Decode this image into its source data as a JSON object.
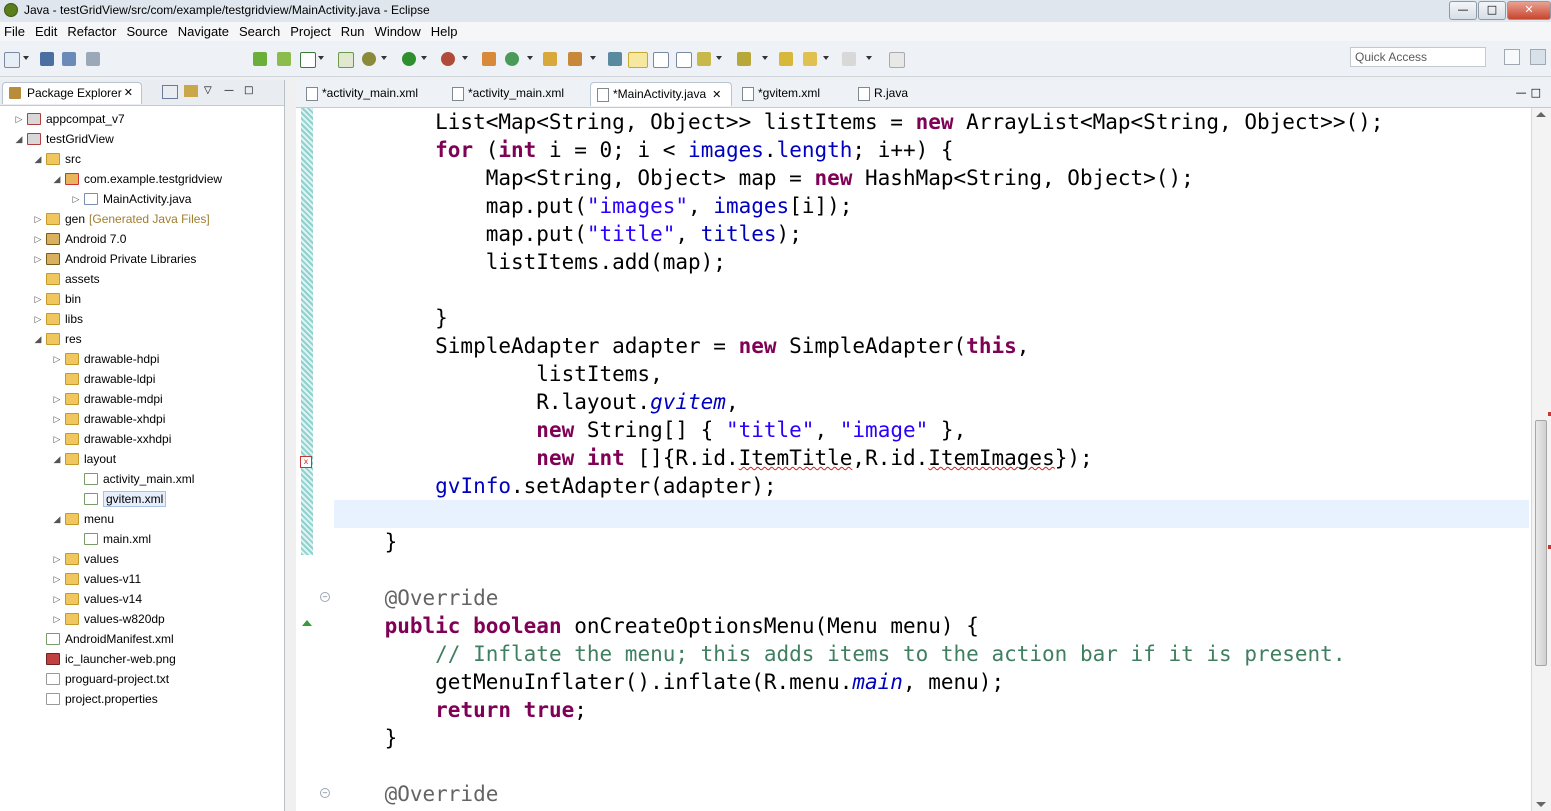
{
  "window": {
    "title": "Java - testGridView/src/com/example/testgridview/MainActivity.java - Eclipse"
  },
  "menu": [
    "File",
    "Edit",
    "Refactor",
    "Source",
    "Navigate",
    "Search",
    "Project",
    "Run",
    "Window",
    "Help"
  ],
  "quick_access": {
    "placeholder": "Quick Access"
  },
  "package_explorer": {
    "tab_label": "Package Explorer",
    "tree": [
      {
        "label": "appcompat_v7",
        "icon": "project-icon",
        "depth": 0,
        "twisty": "collapsed"
      },
      {
        "label": "testGridView",
        "icon": "project-icon",
        "depth": 0,
        "twisty": "expanded"
      },
      {
        "label": "src",
        "icon": "folder-icon",
        "depth": 1,
        "twisty": "expanded"
      },
      {
        "label": "com.example.testgridview",
        "icon": "package-icon",
        "depth": 2,
        "twisty": "expanded"
      },
      {
        "label": "MainActivity.java",
        "icon": "java-file-icon",
        "depth": 3,
        "twisty": "collapsed"
      },
      {
        "label": "gen",
        "decor": "[Generated Java Files]",
        "icon": "folder-icon",
        "depth": 1,
        "twisty": "collapsed"
      },
      {
        "label": "Android 7.0",
        "icon": "library-icon",
        "depth": 1,
        "twisty": "collapsed"
      },
      {
        "label": "Android Private Libraries",
        "icon": "library-icon",
        "depth": 1,
        "twisty": "collapsed"
      },
      {
        "label": "assets",
        "icon": "folder-icon",
        "depth": 1,
        "twisty": "none"
      },
      {
        "label": "bin",
        "icon": "folder-icon",
        "depth": 1,
        "twisty": "collapsed"
      },
      {
        "label": "libs",
        "icon": "folder-icon",
        "depth": 1,
        "twisty": "collapsed"
      },
      {
        "label": "res",
        "icon": "folder-icon",
        "depth": 1,
        "twisty": "expanded"
      },
      {
        "label": "drawable-hdpi",
        "icon": "folder-icon",
        "depth": 2,
        "twisty": "collapsed"
      },
      {
        "label": "drawable-ldpi",
        "icon": "folder-icon",
        "depth": 2,
        "twisty": "none"
      },
      {
        "label": "drawable-mdpi",
        "icon": "folder-icon",
        "depth": 2,
        "twisty": "collapsed"
      },
      {
        "label": "drawable-xhdpi",
        "icon": "folder-icon",
        "depth": 2,
        "twisty": "collapsed"
      },
      {
        "label": "drawable-xxhdpi",
        "icon": "folder-icon",
        "depth": 2,
        "twisty": "collapsed"
      },
      {
        "label": "layout",
        "icon": "folder-icon",
        "depth": 2,
        "twisty": "expanded"
      },
      {
        "label": "activity_main.xml",
        "icon": "xml-file-icon",
        "depth": 3,
        "twisty": "none"
      },
      {
        "label": "gvitem.xml",
        "icon": "xml-file-icon",
        "depth": 3,
        "twisty": "none",
        "selected": true
      },
      {
        "label": "menu",
        "icon": "folder-icon",
        "depth": 2,
        "twisty": "expanded"
      },
      {
        "label": "main.xml",
        "icon": "xml-file-icon",
        "depth": 3,
        "twisty": "none"
      },
      {
        "label": "values",
        "icon": "folder-icon",
        "depth": 2,
        "twisty": "collapsed"
      },
      {
        "label": "values-v11",
        "icon": "folder-icon",
        "depth": 2,
        "twisty": "collapsed"
      },
      {
        "label": "values-v14",
        "icon": "folder-icon",
        "depth": 2,
        "twisty": "collapsed"
      },
      {
        "label": "values-w820dp",
        "icon": "folder-icon",
        "depth": 2,
        "twisty": "collapsed"
      },
      {
        "label": "AndroidManifest.xml",
        "icon": "xml-file-icon",
        "depth": 1,
        "twisty": "none"
      },
      {
        "label": "ic_launcher-web.png",
        "icon": "image-file-icon",
        "depth": 1,
        "twisty": "none"
      },
      {
        "label": "proguard-project.txt",
        "icon": "text-file-icon",
        "depth": 1,
        "twisty": "none"
      },
      {
        "label": "project.properties",
        "icon": "text-file-icon",
        "depth": 1,
        "twisty": "none"
      }
    ]
  },
  "editor_tabs": [
    {
      "label": "*activity_main.xml",
      "active": false,
      "closable": false
    },
    {
      "label": "*activity_main.xml",
      "active": false,
      "closable": false
    },
    {
      "label": "*MainActivity.java",
      "active": true,
      "closable": true
    },
    {
      "label": "*gvitem.xml",
      "active": false,
      "closable": false
    },
    {
      "label": "R.java",
      "active": false,
      "closable": false
    }
  ],
  "code_lines": [
    [
      {
        "t": "        List<Map<String, Object>> listItems = "
      },
      {
        "t": "new",
        "c": "kw"
      },
      {
        "t": " ArrayList<Map<String, Object>>();"
      }
    ],
    [
      {
        "t": "        "
      },
      {
        "t": "for",
        "c": "kw"
      },
      {
        "t": " ("
      },
      {
        "t": "int",
        "c": "kw"
      },
      {
        "t": " i = 0; i < "
      },
      {
        "t": "images",
        "c": "fld"
      },
      {
        "t": "."
      },
      {
        "t": "length",
        "c": "fld"
      },
      {
        "t": "; i++) {"
      }
    ],
    [
      {
        "t": "            Map<String, Object> map = "
      },
      {
        "t": "new",
        "c": "kw"
      },
      {
        "t": " HashMap<String, Object>();"
      }
    ],
    [
      {
        "t": "            map.put("
      },
      {
        "t": "\"images\"",
        "c": "str"
      },
      {
        "t": ", "
      },
      {
        "t": "images",
        "c": "fld"
      },
      {
        "t": "[i]);"
      }
    ],
    [
      {
        "t": "            map.put("
      },
      {
        "t": "\"title\"",
        "c": "str"
      },
      {
        "t": ", "
      },
      {
        "t": "titles",
        "c": "fld"
      },
      {
        "t": ");"
      }
    ],
    [
      {
        "t": "            listItems.add(map);"
      }
    ],
    [
      {
        "t": ""
      }
    ],
    [
      {
        "t": "        }"
      }
    ],
    [
      {
        "t": "        SimpleAdapter adapter = "
      },
      {
        "t": "new",
        "c": "kw"
      },
      {
        "t": " SimpleAdapter("
      },
      {
        "t": "this",
        "c": "kw"
      },
      {
        "t": ","
      }
    ],
    [
      {
        "t": "                listItems,"
      }
    ],
    [
      {
        "t": "                R.layout."
      },
      {
        "t": "gvitem",
        "c": "ital"
      },
      {
        "t": ","
      }
    ],
    [
      {
        "t": "                "
      },
      {
        "t": "new",
        "c": "kw"
      },
      {
        "t": " String[] { "
      },
      {
        "t": "\"title\"",
        "c": "str"
      },
      {
        "t": ", "
      },
      {
        "t": "\"image\"",
        "c": "str"
      },
      {
        "t": " },"
      }
    ],
    [
      {
        "t": "                "
      },
      {
        "t": "new",
        "c": "kw"
      },
      {
        "t": " "
      },
      {
        "t": "int",
        "c": "kw"
      },
      {
        "t": " []{R.id."
      },
      {
        "t": "ItemTitle",
        "c": "squig"
      },
      {
        "t": ",R.id."
      },
      {
        "t": "ItemImages",
        "c": "squig"
      },
      {
        "t": "});"
      }
    ],
    [
      {
        "t": "        "
      },
      {
        "t": "gvInfo",
        "c": "fld"
      },
      {
        "t": ".setAdapter(adapter);"
      }
    ],
    [
      {
        "t": ""
      }
    ],
    [
      {
        "t": "    }"
      }
    ],
    [
      {
        "t": ""
      }
    ],
    [
      {
        "t": "    "
      },
      {
        "t": "@Override",
        "c": "ann"
      }
    ],
    [
      {
        "t": "    "
      },
      {
        "t": "public",
        "c": "kw"
      },
      {
        "t": " "
      },
      {
        "t": "boolean",
        "c": "kw"
      },
      {
        "t": " onCreateOptionsMenu(Menu menu) {"
      }
    ],
    [
      {
        "t": "        "
      },
      {
        "t": "// Inflate the menu; this adds items to the action bar if it is present.",
        "c": "com"
      }
    ],
    [
      {
        "t": "        getMenuInflater().inflate(R.menu."
      },
      {
        "t": "main",
        "c": "ital"
      },
      {
        "t": ", menu);"
      }
    ],
    [
      {
        "t": "        "
      },
      {
        "t": "return",
        "c": "kw"
      },
      {
        "t": " "
      },
      {
        "t": "true",
        "c": "kw"
      },
      {
        "t": ";"
      }
    ],
    [
      {
        "t": "    }"
      }
    ],
    [
      {
        "t": ""
      }
    ],
    [
      {
        "t": "    "
      },
      {
        "t": "@Override",
        "c": "ann"
      }
    ]
  ]
}
